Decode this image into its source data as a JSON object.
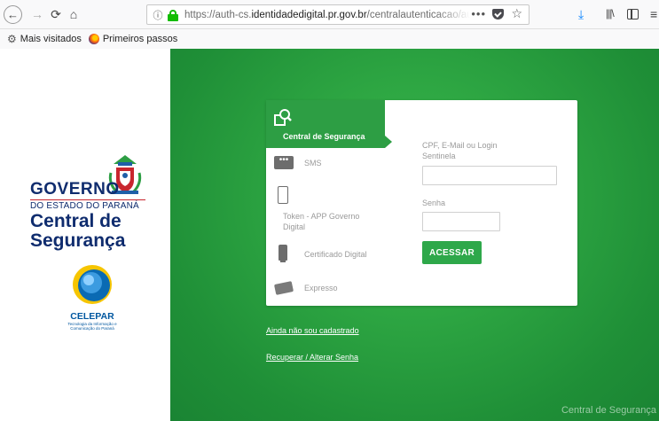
{
  "browser": {
    "url_prefix": "https://auth-cs.",
    "url_host": "identidadedigital.pr.gov.br",
    "url_path": "/centralautenticacao/authentication",
    "bookmarks": [
      {
        "label": "Mais visitados",
        "icon": "gear-icon"
      },
      {
        "label": "Primeiros passos",
        "icon": "firefox-icon"
      }
    ]
  },
  "branding": {
    "gov_word": "GOVERNO",
    "gov_sub": "DO ESTADO DO PARANÁ",
    "central_title": "Central de Segurança",
    "celepar_name": "CELEPAR",
    "celepar_tagline": "Tecnologia da Informação e Comunicação do Paraná",
    "footer": "Central de Segurança"
  },
  "auth_methods": [
    {
      "label": "Central de Segurança",
      "icon": "search-shield-icon",
      "active": true
    },
    {
      "label": "SMS",
      "icon": "sms-icon",
      "active": false
    },
    {
      "label": "Token - APP Governo Digital",
      "icon": "smartphone-icon",
      "active": false
    },
    {
      "label": "Certificado Digital",
      "icon": "usb-token-icon",
      "active": false
    },
    {
      "label": "Expresso",
      "icon": "mail-icon",
      "active": false
    }
  ],
  "form": {
    "user_label": "CPF, E-Mail ou Login Sentinela",
    "user_value": "",
    "password_label": "Senha",
    "password_value": "",
    "submit_label": "ACESSAR"
  },
  "links": {
    "register": "Ainda não sou cadastrado",
    "recover": "Recuperar / Alterar Senha"
  },
  "colors": {
    "brand_green": "#2d9e44",
    "brand_navy": "#0f2c6e",
    "celepar_blue": "#0057a0"
  }
}
